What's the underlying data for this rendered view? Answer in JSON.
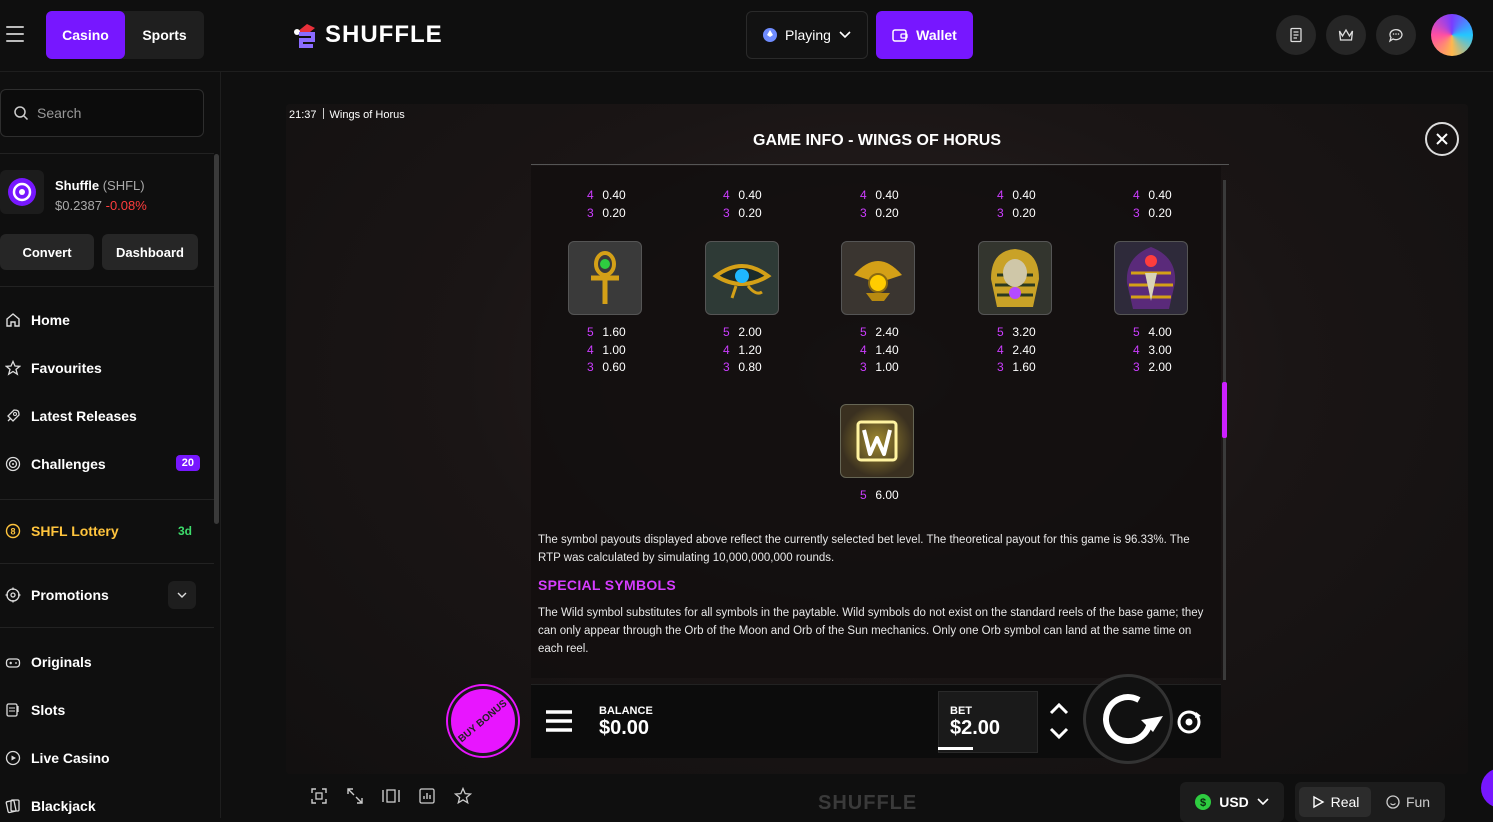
{
  "header": {
    "tabs": [
      {
        "label": "Casino"
      },
      {
        "label": "Sports"
      }
    ],
    "logo_text": "SHUFFLE",
    "playing_label": "Playing",
    "wallet_label": "Wallet",
    "icons": [
      "receipt-icon",
      "crown-icon",
      "chat-icon"
    ]
  },
  "sidebar": {
    "search_placeholder": "Search",
    "token": {
      "name": "Shuffle",
      "ticker": "(SHFL)",
      "price": "$0.2387",
      "change": "-0.08%"
    },
    "convert_label": "Convert",
    "dashboard_label": "Dashboard",
    "nav": [
      {
        "label": "Home",
        "icon": "home-icon"
      },
      {
        "label": "Favourites",
        "icon": "star-icon"
      },
      {
        "label": "Latest Releases",
        "icon": "rocket-icon"
      },
      {
        "label": "Challenges",
        "icon": "target-icon",
        "badge": "20"
      },
      {
        "label": "SHFL Lottery",
        "icon": "lottery-icon",
        "tag": "3d"
      },
      {
        "label": "Promotions",
        "icon": "gift-icon"
      },
      {
        "label": "Originals",
        "icon": "gamepad-icon"
      },
      {
        "label": "Slots",
        "icon": "slots-icon"
      },
      {
        "label": "Live Casino",
        "icon": "live-icon"
      },
      {
        "label": "Blackjack",
        "icon": "cards-icon"
      }
    ]
  },
  "game": {
    "time": "21:37",
    "name": "Wings of Horus",
    "info_title": "GAME INFO - WINGS OF HORUS",
    "top_partial": [
      {
        "p4": "0.40",
        "p3": "0.20"
      },
      {
        "p4": "0.40",
        "p3": "0.20"
      },
      {
        "p4": "0.40",
        "p3": "0.20"
      },
      {
        "p4": "0.40",
        "p3": "0.20"
      },
      {
        "p4": "0.40",
        "p3": "0.20"
      }
    ],
    "symbols": [
      {
        "name": "ankh-symbol",
        "p5": "1.60",
        "p4": "1.00",
        "p3": "0.60",
        "color": "#2ecc40"
      },
      {
        "name": "eye-of-horus-symbol",
        "p5": "2.00",
        "p4": "1.20",
        "p3": "0.80",
        "color": "#1fb7ff"
      },
      {
        "name": "scarab-symbol",
        "p5": "2.40",
        "p4": "1.40",
        "p3": "1.00",
        "color": "#ffcc00"
      },
      {
        "name": "pharaoh-symbol",
        "p5": "3.20",
        "p4": "2.40",
        "p3": "1.60",
        "color": "#b44bff"
      },
      {
        "name": "horus-symbol",
        "p5": "4.00",
        "p4": "3.00",
        "p3": "2.00",
        "color": "#ff3d3d"
      }
    ],
    "wild": {
      "p5": "6.00"
    },
    "rtp_text": "The symbol payouts displayed above reflect the currently selected bet level. The theoretical payout for this game is 96.33%. The RTP was calculated by simulating 10,000,000,000 rounds.",
    "special_title": "SPECIAL SYMBOLS",
    "special_text": "The Wild symbol substitutes for all symbols in the paytable. Wild symbols do not exist on the standard reels of the base game; they can only appear through the Orb of the Moon and Orb of the Sun mechanics. Only one Orb symbol can land at the same time on each reel.",
    "buy_bonus_label": "BUY BONUS",
    "balance_label": "BALANCE",
    "balance_value": "$0.00",
    "bet_label": "BET",
    "bet_value": "$2.00"
  },
  "bottom": {
    "watermark": "SHUFFLE",
    "currency": "USD",
    "real_label": "Real",
    "fun_label": "Fun"
  },
  "colors": {
    "accent": "#7717ff",
    "magenta": "#cc3dff",
    "loss": "#ff3d3d"
  }
}
